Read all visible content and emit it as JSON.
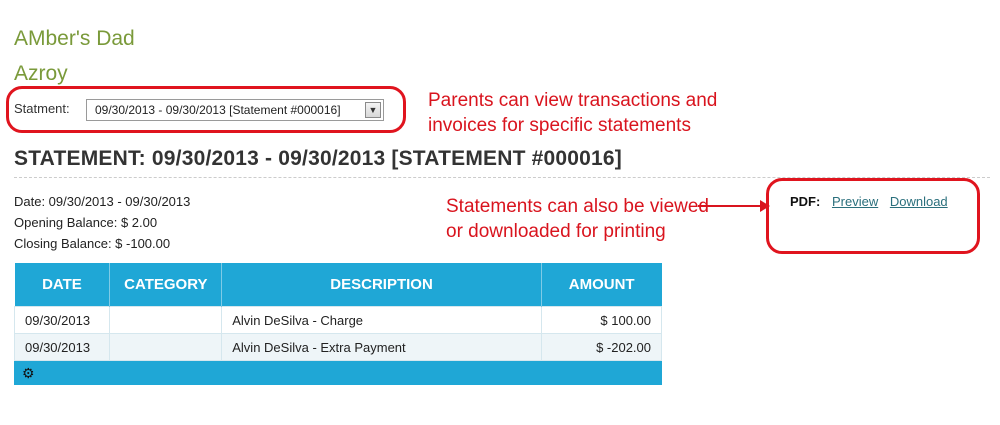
{
  "header": {
    "parent_name": "AMber's Dad",
    "child_name": "Azroy"
  },
  "statement_select": {
    "label": "Statment:",
    "value": "09/30/2013 - 09/30/2013 [Statement #000016]"
  },
  "annotations": {
    "statement_note_1": "Parents can view transactions and",
    "statement_note_2": "invoices for specific statements",
    "pdf_note_1": "Statements can also be viewed",
    "pdf_note_2": "or downloaded for printing",
    "color": "#d9141e"
  },
  "statement": {
    "title": "STATEMENT: 09/30/2013 - 09/30/2013 [STATEMENT #000016]",
    "date_line": "Date: 09/30/2013 - 09/30/2013",
    "opening_line": "Opening Balance: $ 2.00",
    "closing_line": "Closing Balance: $ -100.00"
  },
  "pdf": {
    "label": "PDF:",
    "preview": "Preview",
    "download": "Download"
  },
  "table": {
    "headers": {
      "date": "DATE",
      "category": "CATEGORY",
      "description": "DESCRIPTION",
      "amount": "AMOUNT"
    },
    "rows": [
      {
        "date": "09/30/2013",
        "category": "",
        "description": "Alvin DeSilva - Charge",
        "amount": "$ 100.00"
      },
      {
        "date": "09/30/2013",
        "category": "",
        "description": "Alvin DeSilva - Extra Payment",
        "amount": "$ -202.00"
      }
    ],
    "header_color": "#1fa7d6"
  },
  "icons": {
    "select_arrow": "chevron-down-icon",
    "settings": "gear-icon"
  }
}
